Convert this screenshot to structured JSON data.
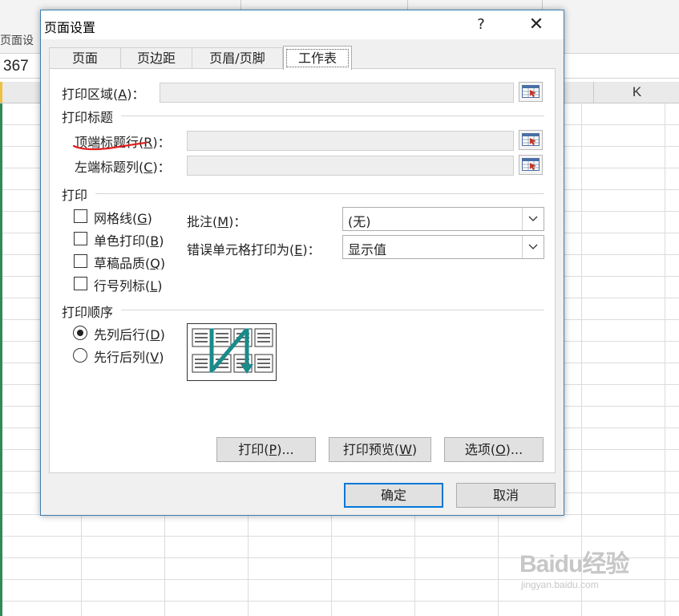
{
  "background": {
    "group_label": "页面设",
    "name_box": "367",
    "column_k": "K"
  },
  "dialog": {
    "title": "页面设置",
    "help": "?",
    "close": "✕",
    "tabs": [
      {
        "label": "页面"
      },
      {
        "label": "页边距"
      },
      {
        "label": "页眉/页脚"
      },
      {
        "label": "工作表",
        "active": true
      }
    ],
    "print_area": {
      "label": "打印区域",
      "key": "A",
      "value": ""
    },
    "print_titles": {
      "header": "打印标题",
      "rows": {
        "label": "顶端标题行",
        "key": "R",
        "value": ""
      },
      "cols": {
        "label": "左端标题列",
        "key": "C",
        "value": ""
      }
    },
    "print": {
      "header": "打印",
      "checkboxes": [
        {
          "label": "网格线",
          "key": "G",
          "checked": false
        },
        {
          "label": "单色打印",
          "key": "B",
          "checked": false
        },
        {
          "label": "草稿品质",
          "key": "Q",
          "checked": false
        },
        {
          "label": "行号列标",
          "key": "L",
          "checked": false
        }
      ],
      "comments": {
        "label": "批注",
        "key": "M",
        "value": "(无)"
      },
      "errors": {
        "label": "错误单元格打印为",
        "key": "E",
        "value": "显示值"
      }
    },
    "order": {
      "header": "打印顺序",
      "options": [
        {
          "label": "先列后行",
          "key": "D",
          "selected": true
        },
        {
          "label": "先行后列",
          "key": "V",
          "selected": false
        }
      ]
    },
    "buttons": {
      "print": {
        "label": "打印",
        "key": "P",
        "suffix": "..."
      },
      "preview": {
        "label": "打印预览",
        "key": "W",
        "suffix": ""
      },
      "options": {
        "label": "选项",
        "key": "O",
        "suffix": "..."
      },
      "ok": "确定",
      "cancel": "取消"
    }
  },
  "watermark": {
    "logo": "Baidu经验",
    "url": "jingyan.baidu.com"
  },
  "colors": {
    "accent": "#0078d7",
    "annotation": "#e02020",
    "order_arrow": "#1a8a8a"
  }
}
